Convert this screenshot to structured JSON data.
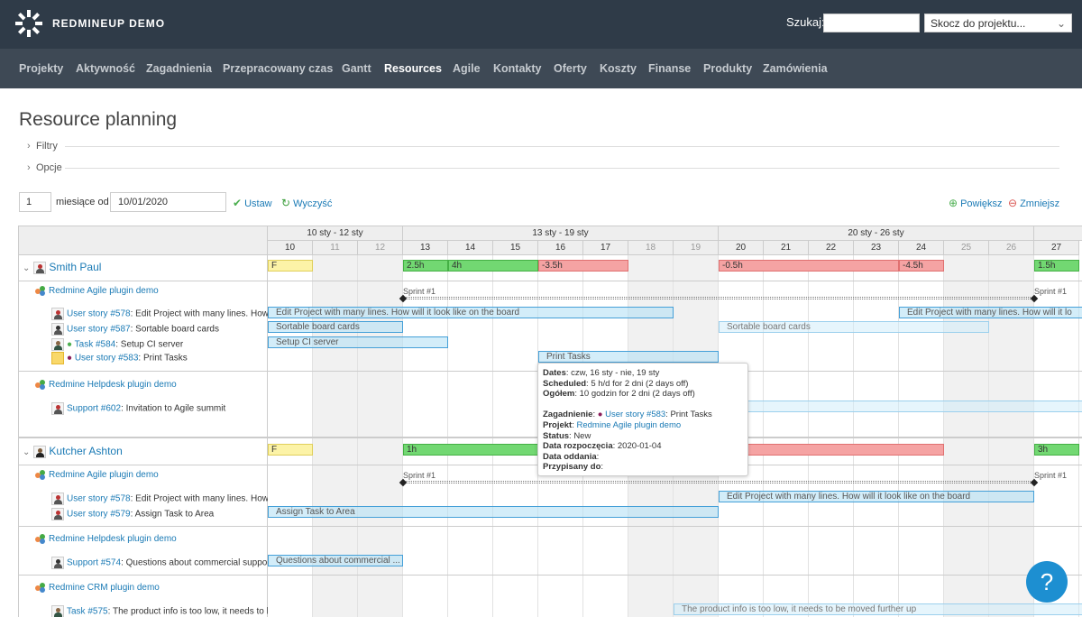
{
  "app": {
    "title": "REDMINEUP DEMO"
  },
  "header": {
    "search_label": "Szukaj:",
    "search_value": "",
    "project_jump": "Skocz do projektu..."
  },
  "menu": [
    "Projekty",
    "Aktywność",
    "Zagadnienia",
    "Przepracowany czas",
    "Gantt",
    "Resources",
    "Agile",
    "Kontakty",
    "Oferty",
    "Koszty",
    "Finanse",
    "Produkty",
    "Zamówienia"
  ],
  "menu_selected": "Resources",
  "page": {
    "title": "Resource planning",
    "filters": "Filtry",
    "options": "Opcje"
  },
  "controls": {
    "months": "1",
    "months_label": "miesiące od",
    "date": "10/01/2020",
    "apply": "Ustaw",
    "clear": "Wyczyść",
    "zoom_in": "Powiększ",
    "zoom_out": "Zmniejsz"
  },
  "weeks": [
    "10 sty - 12 sty",
    "13 sty - 19 sty",
    "20 sty - 26 sty"
  ],
  "days": [
    "10",
    "11",
    "12",
    "13",
    "14",
    "15",
    "16",
    "17",
    "18",
    "19",
    "20",
    "21",
    "22",
    "23",
    "24",
    "25",
    "26",
    "27"
  ],
  "users": [
    {
      "name": "Smith Paul"
    },
    {
      "name": "Kutcher Ashton"
    }
  ],
  "rows": {
    "p1": "Redmine Agile plugin demo",
    "r1a_link": "User story #578",
    "r1a_text": ": Edit Project with many lines. How ...",
    "r1b_link": "User story #587",
    "r1b_text": ": Sortable board cards",
    "r1c_link": "Task #584",
    "r1c_text": ": Setup CI server",
    "r1d_link": "User story #583",
    "r1d_text": ": Print Tasks",
    "p2": "Redmine Helpdesk plugin demo",
    "r2a_link": "Support #602",
    "r2a_text": ": Invitation to Agile summit",
    "p3": "Redmine Agile plugin demo",
    "r3a_link": "User story #578",
    "r3a_text": ": Edit Project with many lines. How ...",
    "r3b_link": "User story #579",
    "r3b_text": ": Assign Task to Area",
    "p4": "Redmine Helpdesk plugin demo",
    "r4a_link": "Support #574",
    "r4a_text": ": Questions about commercial support",
    "p5": "Redmine CRM plugin demo",
    "r5a_link": "Task #575",
    "r5a_text": ": The product info is too low, it needs to b..."
  },
  "load_bars": {
    "u1": [
      "F",
      "2.5h",
      "4h",
      "-3.5h",
      "-0.5h",
      "-4.5h",
      "1.5h"
    ],
    "u2": [
      "F",
      "1h",
      "3h"
    ]
  },
  "sprint": "Sprint #1",
  "task_bars": {
    "t1": "Edit Project with many lines. How will it look like on the board",
    "t2": "Sortable board cards",
    "t3": "Setup CI server",
    "t4": "Print Tasks",
    "t5": "Edit Project with many lines. How will it look like on the board",
    "t6": "Assign Task to Area",
    "t7": "Questions about commercial ...",
    "t8": "The product info is too low, it needs to be moved further up",
    "t1b": "Edit Project with many lines. How will it lo"
  },
  "tooltip": {
    "dates_l": "Dates",
    "dates_v": ": czw, 16 sty - nie, 19 sty",
    "sched_l": "Scheduled",
    "sched_v": ": 5 h/d for 2 dni (2 days off)",
    "total_l": "Ogółem",
    "total_v": ": 10 godzin for 2 dni (2 days off)",
    "issue_l": "Zagadnienie",
    "issue_link": "User story #583",
    "issue_v": ": Print Tasks",
    "proj_l": "Projekt",
    "proj_link": "Redmine Agile plugin demo",
    "status_l": "Status",
    "status_v": ": New",
    "start_l": "Data rozpoczęcia",
    "start_v": ": 2020-01-04",
    "due_l": "Data oddania",
    "due_v": ":",
    "assign_l": "Przypisany do",
    "assign_v": ":"
  },
  "help": "?",
  "colors": {
    "topbar": "#2f3b48",
    "menu": "#3e4955",
    "link": "#1a7ab5",
    "green": "#72d872",
    "red": "#f5a3a3",
    "yellow": "#fcf3a7"
  }
}
